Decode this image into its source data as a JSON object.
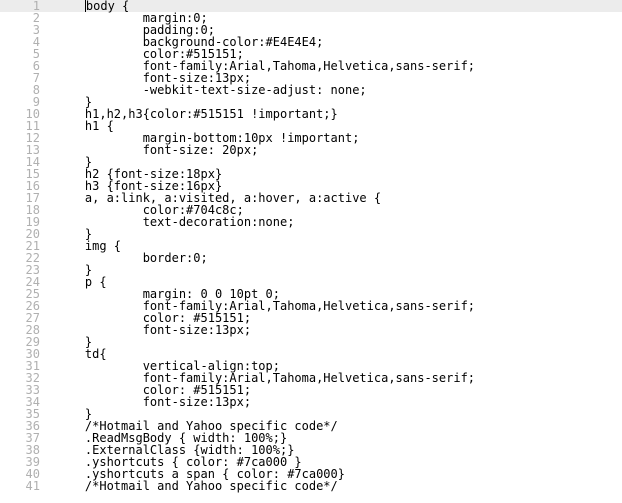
{
  "editor": {
    "highlight_line": 1,
    "lines": [
      {
        "n": 1,
        "indent": 1,
        "text": "body {"
      },
      {
        "n": 2,
        "indent": 3,
        "text": "margin:0;"
      },
      {
        "n": 3,
        "indent": 3,
        "text": "padding:0;"
      },
      {
        "n": 4,
        "indent": 3,
        "text": "background-color:#E4E4E4;"
      },
      {
        "n": 5,
        "indent": 3,
        "text": "color:#515151;"
      },
      {
        "n": 6,
        "indent": 3,
        "text": "font-family:Arial,Tahoma,Helvetica,sans-serif;"
      },
      {
        "n": 7,
        "indent": 3,
        "text": "font-size:13px;"
      },
      {
        "n": 8,
        "indent": 3,
        "text": "-webkit-text-size-adjust: none;"
      },
      {
        "n": 9,
        "indent": 1,
        "text": "}"
      },
      {
        "n": 10,
        "indent": 1,
        "text": "h1,h2,h3{color:#515151 !important;}"
      },
      {
        "n": 11,
        "indent": 1,
        "text": "h1 {"
      },
      {
        "n": 12,
        "indent": 3,
        "text": "margin-bottom:10px !important;"
      },
      {
        "n": 13,
        "indent": 3,
        "text": "font-size: 20px;"
      },
      {
        "n": 14,
        "indent": 1,
        "text": "}"
      },
      {
        "n": 15,
        "indent": 1,
        "text": "h2 {font-size:18px}"
      },
      {
        "n": 16,
        "indent": 1,
        "text": "h3 {font-size:16px}"
      },
      {
        "n": 17,
        "indent": 1,
        "text": "a, a:link, a:visited, a:hover, a:active {"
      },
      {
        "n": 18,
        "indent": 3,
        "text": "color:#704c8c;"
      },
      {
        "n": 19,
        "indent": 3,
        "text": "text-decoration:none;"
      },
      {
        "n": 20,
        "indent": 1,
        "text": "}"
      },
      {
        "n": 21,
        "indent": 1,
        "text": "img {"
      },
      {
        "n": 22,
        "indent": 3,
        "text": "border:0;"
      },
      {
        "n": 23,
        "indent": 1,
        "text": "}"
      },
      {
        "n": 24,
        "indent": 1,
        "text": "p {"
      },
      {
        "n": 25,
        "indent": 3,
        "text": "margin: 0 0 10pt 0;"
      },
      {
        "n": 26,
        "indent": 3,
        "text": "font-family:Arial,Tahoma,Helvetica,sans-serif;"
      },
      {
        "n": 27,
        "indent": 3,
        "text": "color: #515151;"
      },
      {
        "n": 28,
        "indent": 3,
        "text": "font-size:13px;"
      },
      {
        "n": 29,
        "indent": 1,
        "text": "}"
      },
      {
        "n": 30,
        "indent": 1,
        "text": "td{"
      },
      {
        "n": 31,
        "indent": 3,
        "text": "vertical-align:top;"
      },
      {
        "n": 32,
        "indent": 3,
        "text": "font-family:Arial,Tahoma,Helvetica,sans-serif;"
      },
      {
        "n": 33,
        "indent": 3,
        "text": "color: #515151;"
      },
      {
        "n": 34,
        "indent": 3,
        "text": "font-size:13px;"
      },
      {
        "n": 35,
        "indent": 1,
        "text": "}"
      },
      {
        "n": 36,
        "indent": 1,
        "text": "/*Hotmail and Yahoo specific code*/"
      },
      {
        "n": 37,
        "indent": 1,
        "text": ".ReadMsgBody { width: 100%;}"
      },
      {
        "n": 38,
        "indent": 1,
        "text": ".ExternalClass {width: 100%;}"
      },
      {
        "n": 39,
        "indent": 1,
        "text": ".yshortcuts { color: #7ca000 }"
      },
      {
        "n": 40,
        "indent": 1,
        "text": ".yshortcuts a span { color: #7ca000}"
      },
      {
        "n": 41,
        "indent": 1,
        "text": "/*Hotmail and Yahoo specific code*/"
      }
    ]
  }
}
